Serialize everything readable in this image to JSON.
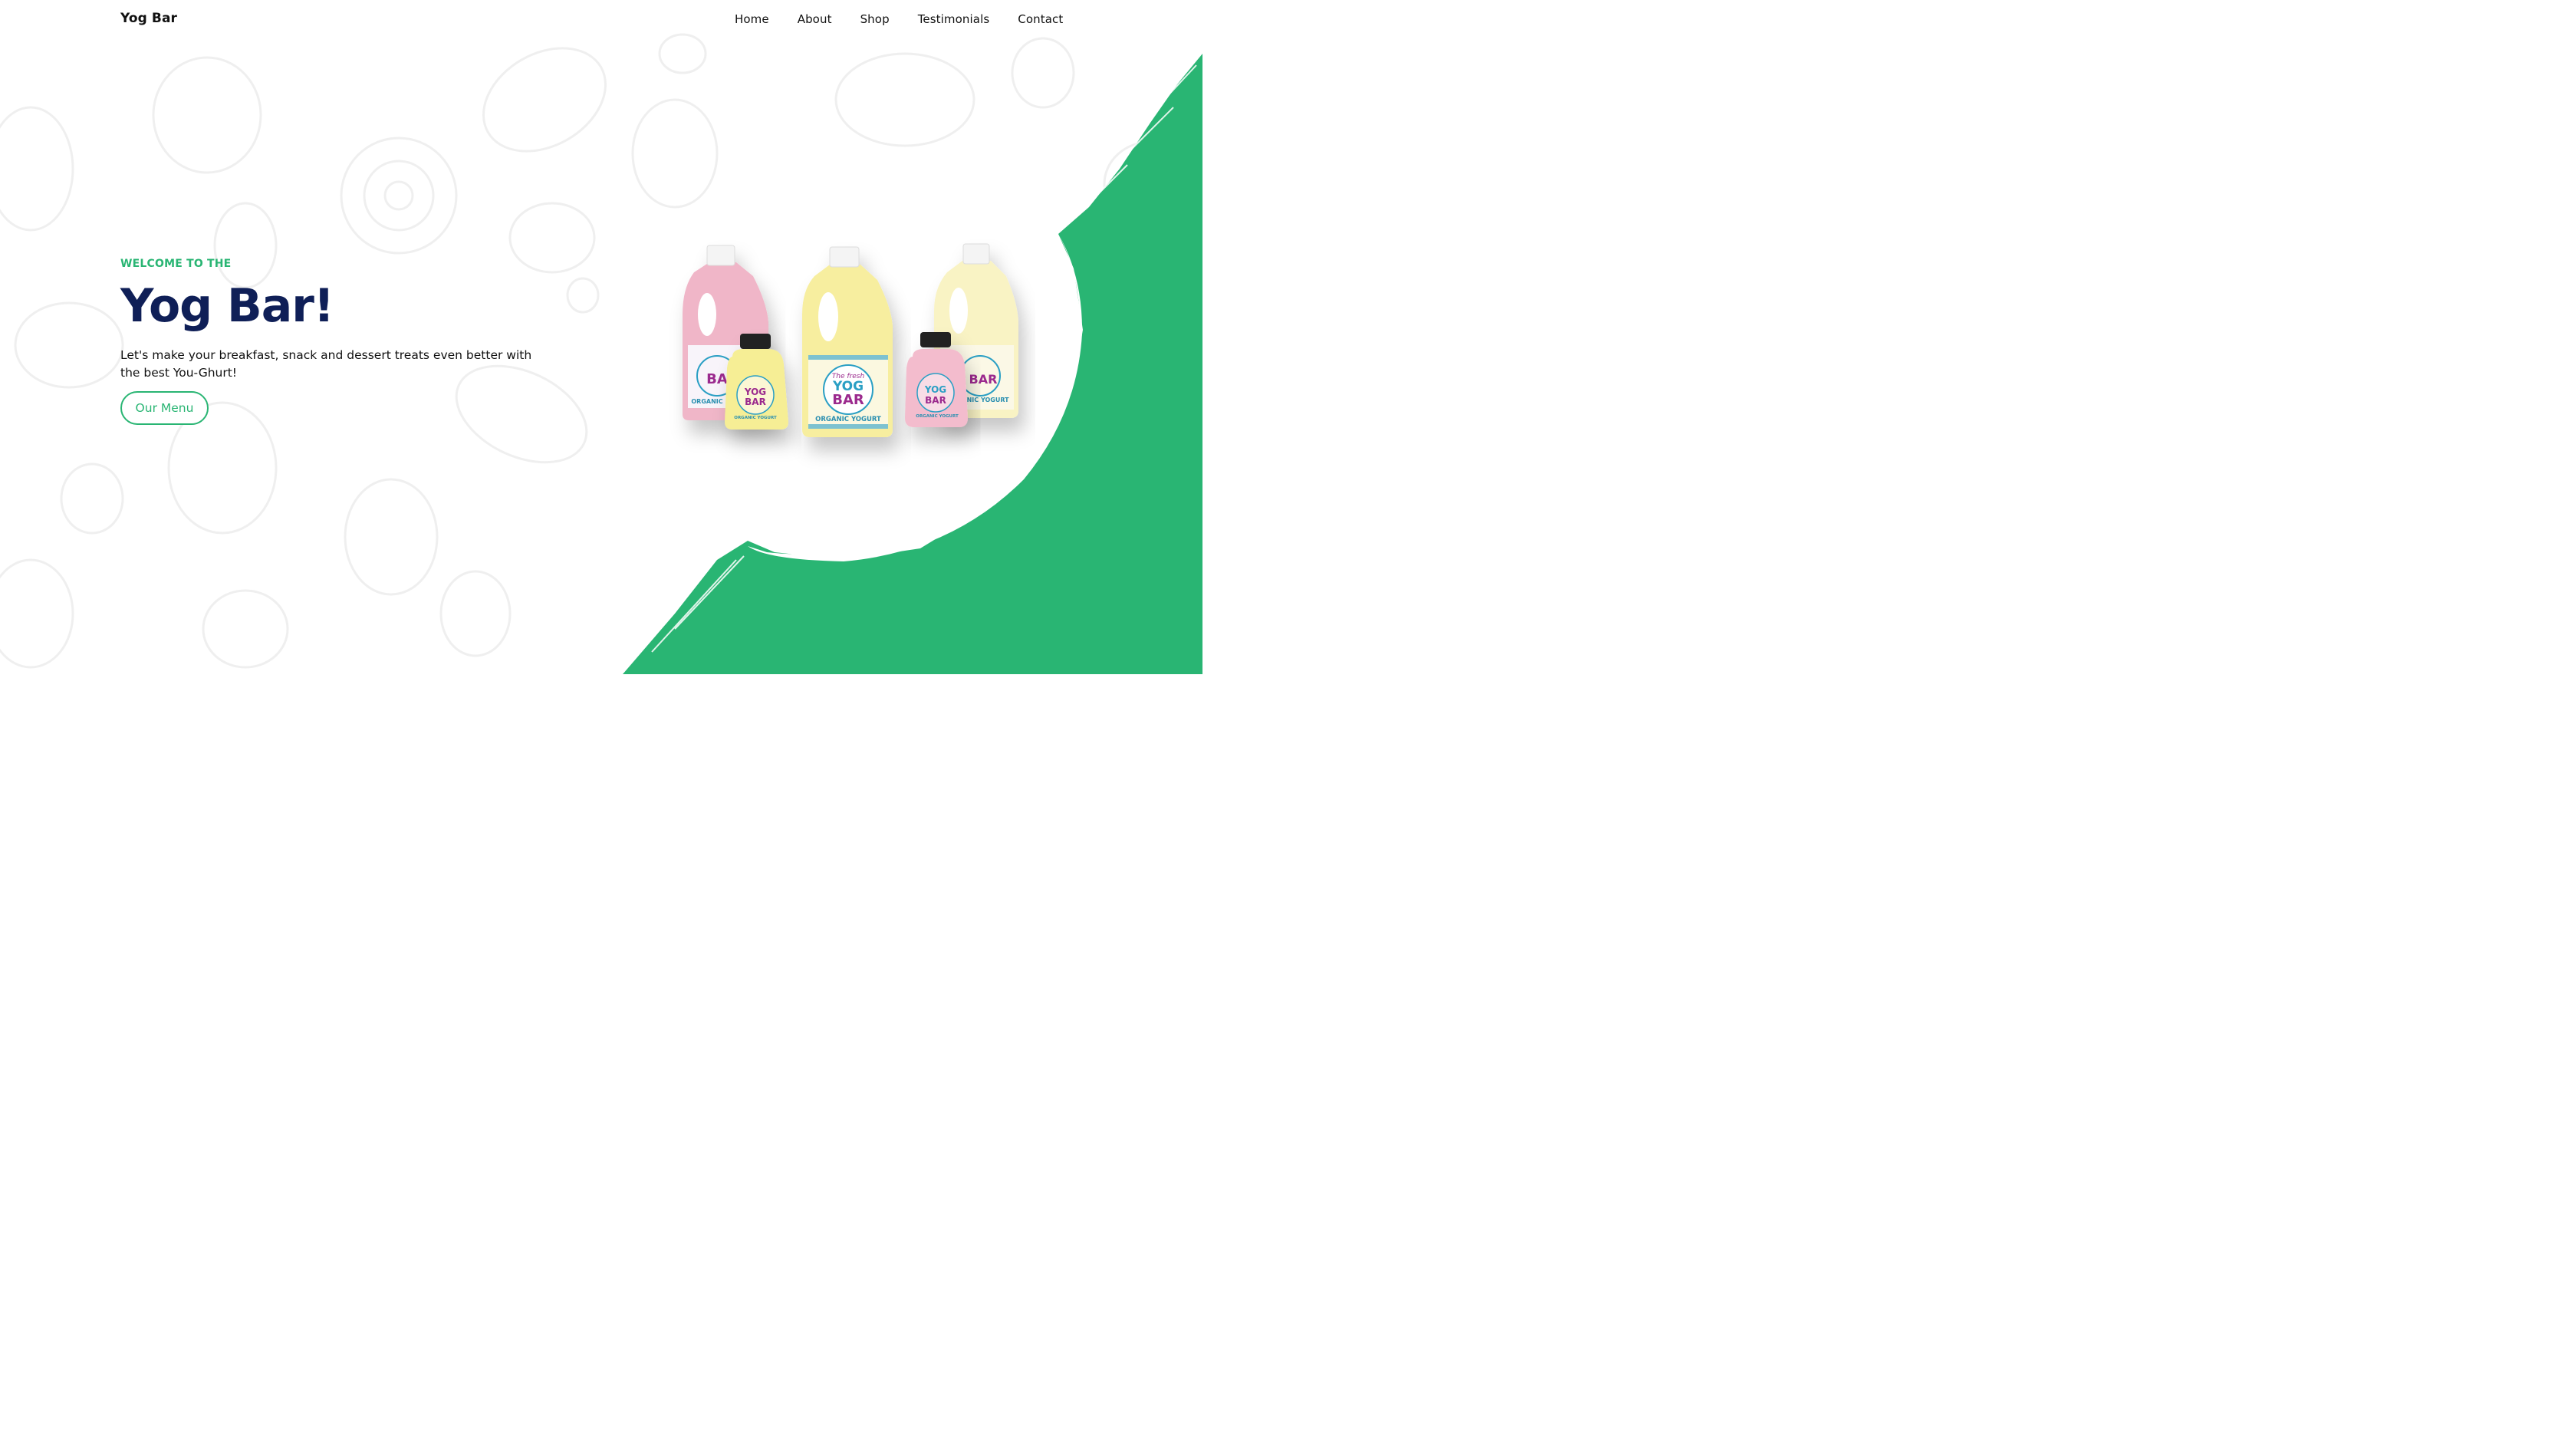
{
  "nav": {
    "brand": "Yog Bar",
    "links": [
      "Home",
      "About",
      "Shop",
      "Testimonials",
      "Contact"
    ]
  },
  "hero": {
    "eyebrow": "WELCOME TO THE",
    "title": "Yog Bar!",
    "description": "Let's make your breakfast, snack and dessert treats even better with the best You-Ghurt!",
    "button_label": "Our Menu"
  },
  "product_image": {
    "bottles": [
      {
        "label_top": "The fresh",
        "label_main": "YOG",
        "label_main2": "BAR",
        "label_bottom": "ORGANIC YOGURT"
      }
    ]
  },
  "colors": {
    "accent_green": "#29b573",
    "title_navy": "#0f1f57",
    "strawberry": "#f2bccd",
    "vanilla": "#f7efa6"
  }
}
